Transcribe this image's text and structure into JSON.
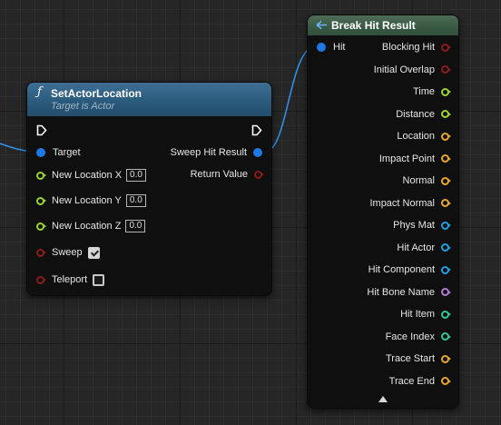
{
  "colors": {
    "struct": "#1e78e6",
    "vector": "#e8a825",
    "bool": "#8a1b1b",
    "float": "#9bd42e",
    "object": "#1a9fe0",
    "name": "#b07ad8",
    "int": "#2ec79a",
    "exec": "#ffffff"
  },
  "set_actor_location": {
    "title": "SetActorLocation",
    "subtitle": "Target is Actor",
    "icon": "function-icon",
    "inputs": {
      "target": "Target",
      "new_location_x": "New Location X",
      "new_location_x_value": "0.0",
      "new_location_y": "New Location Y",
      "new_location_y_value": "0.0",
      "new_location_z": "New Location Z",
      "new_location_z_value": "0.0",
      "sweep": "Sweep",
      "teleport": "Teleport"
    },
    "outputs": {
      "sweep_hit_result": "Sweep Hit Result",
      "return_value": "Return Value"
    }
  },
  "break_hit_result": {
    "title": "Break Hit Result",
    "icon": "break-struct-icon",
    "input": "Hit",
    "outputs": [
      {
        "label": "Blocking Hit",
        "type": "bool"
      },
      {
        "label": "Initial Overlap",
        "type": "bool"
      },
      {
        "label": "Time",
        "type": "float"
      },
      {
        "label": "Distance",
        "type": "float"
      },
      {
        "label": "Location",
        "type": "vector"
      },
      {
        "label": "Impact Point",
        "type": "vector"
      },
      {
        "label": "Normal",
        "type": "vector"
      },
      {
        "label": "Impact Normal",
        "type": "vector"
      },
      {
        "label": "Phys Mat",
        "type": "object"
      },
      {
        "label": "Hit Actor",
        "type": "object"
      },
      {
        "label": "Hit Component",
        "type": "object"
      },
      {
        "label": "Hit Bone Name",
        "type": "name"
      },
      {
        "label": "Hit Item",
        "type": "int"
      },
      {
        "label": "Face Index",
        "type": "int"
      },
      {
        "label": "Trace Start",
        "type": "vector"
      },
      {
        "label": "Trace End",
        "type": "vector"
      }
    ]
  }
}
